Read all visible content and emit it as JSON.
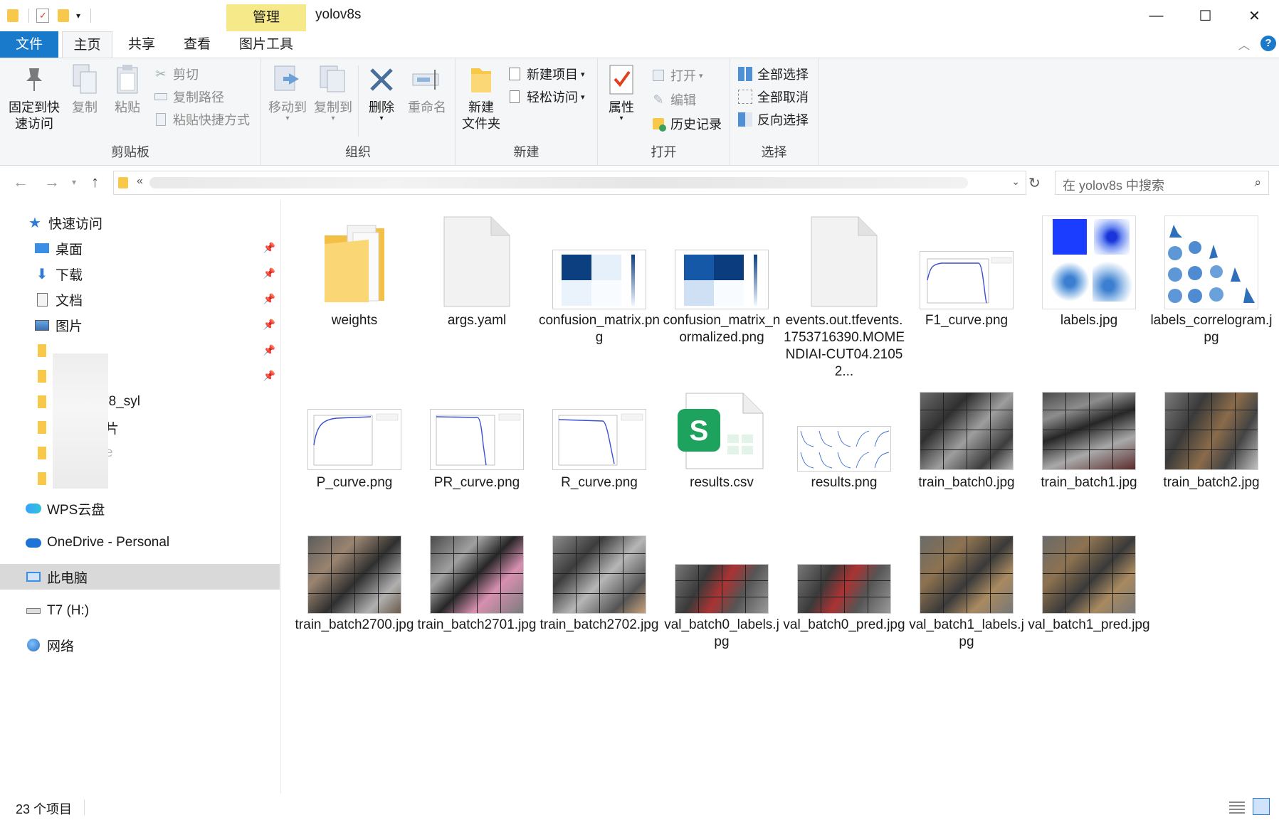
{
  "window": {
    "title": "yolov8s",
    "context_tab": "管理",
    "minimize": "—",
    "maximize": "☐",
    "close": "✕"
  },
  "tabs": {
    "file": "文件",
    "home": "主页",
    "share": "共享",
    "view": "查看",
    "picture_tools": "图片工具"
  },
  "ribbon": {
    "clipboard": {
      "label": "剪贴板",
      "pin": "固定到快\n速访问",
      "copy": "复制",
      "paste": "粘贴",
      "cut": "剪切",
      "copy_path": "复制路径",
      "paste_shortcut": "粘贴快捷方式"
    },
    "organize": {
      "label": "组织",
      "move_to": "移动到",
      "copy_to": "复制到",
      "delete": "删除",
      "rename": "重命名"
    },
    "new": {
      "label": "新建",
      "new_folder": "新建\n文件夹",
      "new_item": "新建项目",
      "easy_access": "轻松访问"
    },
    "open": {
      "label": "打开",
      "properties": "属性",
      "open": "打开",
      "edit": "编辑",
      "history": "历史记录"
    },
    "select": {
      "label": "选择",
      "select_all": "全部选择",
      "select_none": "全部取消",
      "invert": "反向选择"
    }
  },
  "address": {
    "path_prefix": "«",
    "search_placeholder": "在 yolov8s 中搜索"
  },
  "nav": {
    "quick_access": "快速访问",
    "desktop": "桌面",
    "downloads": "下载",
    "documents": "文档",
    "pictures": "图片",
    "partial1": "08_syl",
    "partial2": "片",
    "partial3": "e",
    "wps": "WPS云盘",
    "onedrive": "OneDrive - Personal",
    "this_pc": "此电脑",
    "t7": "T7 (H:)",
    "network": "网络"
  },
  "files": [
    {
      "name": "weights",
      "kind": "folder"
    },
    {
      "name": "args.yaml",
      "kind": "blank"
    },
    {
      "name": "confusion_matrix.png",
      "kind": "cm"
    },
    {
      "name": "confusion_matrix_normalized.png",
      "kind": "cmn"
    },
    {
      "name": "events.out.tfevents.1753716390.MOMENDIAI-CUT04.21052...",
      "kind": "blank"
    },
    {
      "name": "F1_curve.png",
      "kind": "curve"
    },
    {
      "name": "labels.jpg",
      "kind": "labels"
    },
    {
      "name": "labels_correlogram.jpg",
      "kind": "correlogram"
    },
    {
      "name": "P_curve.png",
      "kind": "curve"
    },
    {
      "name": "PR_curve.png",
      "kind": "curve"
    },
    {
      "name": "R_curve.png",
      "kind": "curve"
    },
    {
      "name": "results.csv",
      "kind": "csv"
    },
    {
      "name": "results.png",
      "kind": "results"
    },
    {
      "name": "train_batch0.jpg",
      "kind": "batch"
    },
    {
      "name": "train_batch1.jpg",
      "kind": "batch"
    },
    {
      "name": "train_batch2.jpg",
      "kind": "batch"
    },
    {
      "name": "train_batch2700.jpg",
      "kind": "batch"
    },
    {
      "name": "train_batch2701.jpg",
      "kind": "batch"
    },
    {
      "name": "train_batch2702.jpg",
      "kind": "batch"
    },
    {
      "name": "val_batch0_labels.jpg",
      "kind": "valbatch"
    },
    {
      "name": "val_batch0_pred.jpg",
      "kind": "valbatch"
    },
    {
      "name": "val_batch1_labels.jpg",
      "kind": "valbatch"
    },
    {
      "name": "val_batch1_pred.jpg",
      "kind": "valbatch"
    }
  ],
  "status": {
    "count": "23 个项目"
  }
}
